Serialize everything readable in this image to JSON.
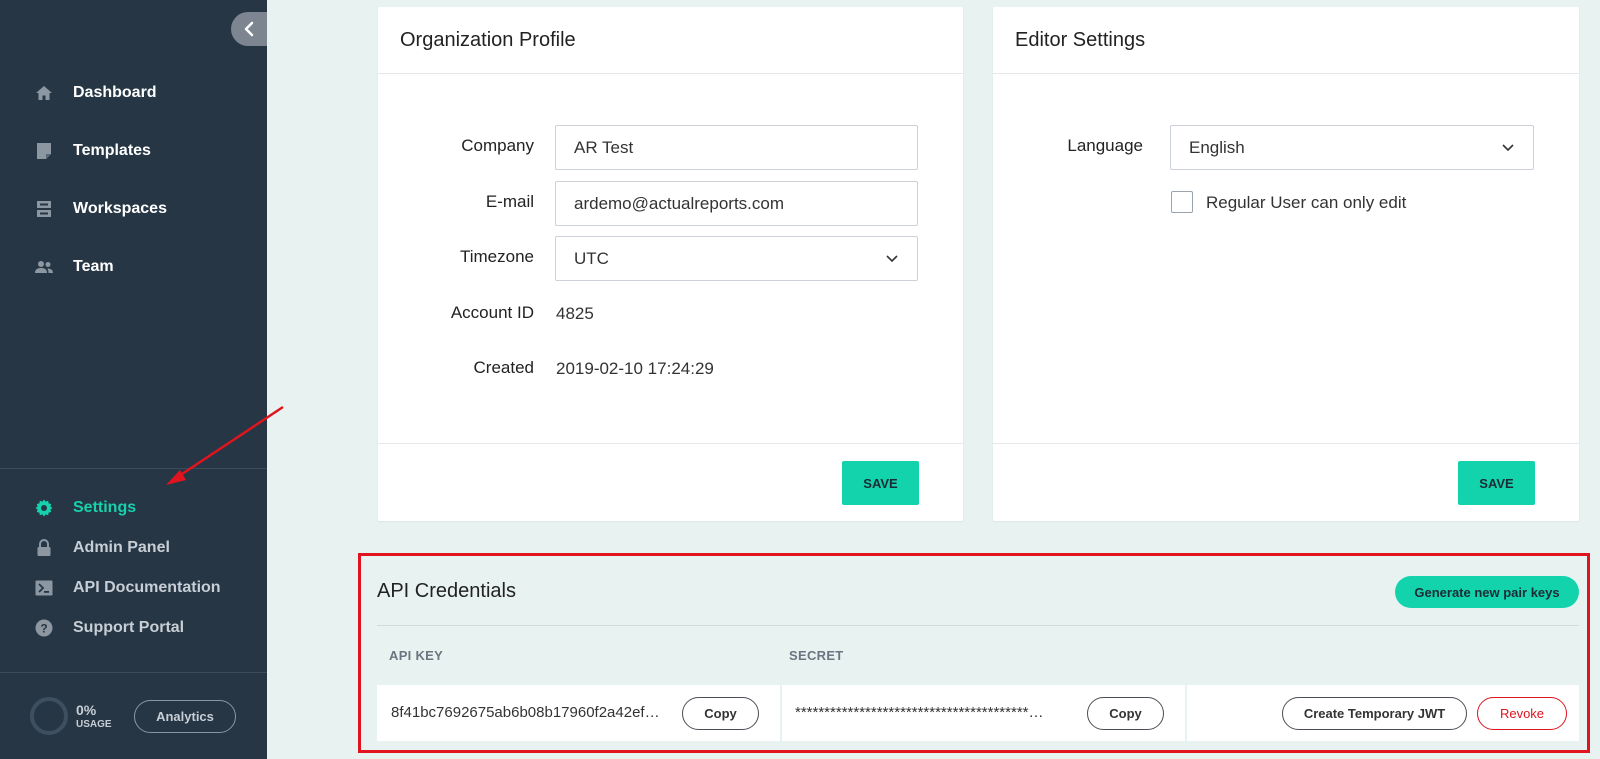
{
  "sidebar": {
    "nav_top": [
      {
        "label": "Dashboard",
        "icon": "home-icon"
      },
      {
        "label": "Templates",
        "icon": "document-icon"
      },
      {
        "label": "Workspaces",
        "icon": "server-icon"
      },
      {
        "label": "Team",
        "icon": "people-icon"
      }
    ],
    "nav_bottom": [
      {
        "label": "Settings",
        "icon": "gear-icon",
        "active": true
      },
      {
        "label": "Admin Panel",
        "icon": "lock-icon"
      },
      {
        "label": "API Documentation",
        "icon": "terminal-icon"
      },
      {
        "label": "Support Portal",
        "icon": "help-icon"
      }
    ],
    "usage_percent": "0%",
    "usage_label": "USAGE",
    "analytics_label": "Analytics"
  },
  "org_profile": {
    "title": "Organization Profile",
    "company_label": "Company",
    "company_value": "AR Test",
    "email_label": "E-mail",
    "email_value": "ardemo@actualreports.com",
    "timezone_label": "Timezone",
    "timezone_value": "UTC",
    "account_id_label": "Account ID",
    "account_id_value": "4825",
    "created_label": "Created",
    "created_value": "2019-02-10 17:24:29",
    "save_label": "SAVE"
  },
  "editor_settings": {
    "title": "Editor Settings",
    "language_label": "Language",
    "language_value": "English",
    "checkbox_label": "Regular User can only edit",
    "checkbox_checked": false,
    "save_label": "SAVE"
  },
  "api_credentials": {
    "title": "API Credentials",
    "generate_label": "Generate new pair keys",
    "col_api_key": "API KEY",
    "col_secret": "SECRET",
    "api_key_value": "8f41bc7692675ab6b08b17960f2a42ef…",
    "secret_value": "****************************************…",
    "copy_label": "Copy",
    "jwt_label": "Create Temporary JWT",
    "revoke_label": "Revoke"
  },
  "colors": {
    "sidebar_bg": "#263645",
    "accent": "#13d3ad",
    "highlight_red": "#e0141e",
    "page_bg": "#e8f3f1"
  }
}
